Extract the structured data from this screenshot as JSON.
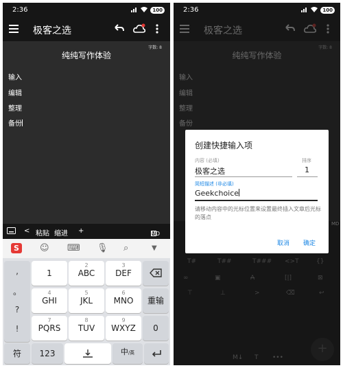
{
  "status": {
    "time": "2:36",
    "battery": "100"
  },
  "app": {
    "title": "极客之选"
  },
  "editor": {
    "word_count": "字数: 8",
    "doc_title": "纯纯写作体验",
    "lines": [
      "输入",
      "编辑",
      "整理",
      "备份"
    ]
  },
  "edit_toolbar": {
    "back": "<",
    "paste": "粘贴",
    "indent": "缩进",
    "add": "+",
    "md": "MD"
  },
  "keyboard": {
    "symbols": [
      ",",
      "。",
      "?",
      "!"
    ],
    "row1": [
      {
        "num": "1",
        "main": ""
      },
      {
        "num": "2",
        "main": "ABC"
      },
      {
        "num": "3",
        "main": "DEF"
      }
    ],
    "row2": [
      {
        "num": "4",
        "main": "GHI"
      },
      {
        "num": "5",
        "main": "JKL"
      },
      {
        "num": "6",
        "main": "MNO"
      }
    ],
    "row3": [
      {
        "num": "7",
        "main": "PQRS"
      },
      {
        "num": "8",
        "main": "TUV"
      },
      {
        "num": "9",
        "main": "WXYZ"
      }
    ],
    "reenter": "重输",
    "zero": "0",
    "symbol_key": "符",
    "num_key": "123",
    "lang_key_main": "中",
    "lang_key_sub": "/英"
  },
  "dialog": {
    "title": "创建快捷输入项",
    "content_label": "内容 (必填)",
    "content_value": "极客之选",
    "order_label": "排序",
    "order_value": "1",
    "desc_label": "简短描述 (非必填)",
    "desc_value": "Geekchoice",
    "hint": "请移动内容中的光标位置来设置最终插入文章后光标的落点",
    "cancel": "取消",
    "confirm": "确定"
  },
  "tools": {
    "row1": [
      "T#",
      "T##",
      "T###",
      "<>T",
      "{}"
    ],
    "row2": [
      "∞",
      "▣",
      "A",
      "[|]",
      "⊠"
    ],
    "row3": [
      "⊤",
      "⊥",
      ">",
      "⌫",
      "↩"
    ]
  },
  "bottom_tabs": [
    "M↓",
    "T",
    "•••"
  ],
  "colors": {
    "accent": "#1e88e5",
    "dark_bg": "#161616",
    "editor_bg": "#2c2c2c",
    "keyboard_bg": "#dfe1e5",
    "sogou_red": "#e53935"
  }
}
